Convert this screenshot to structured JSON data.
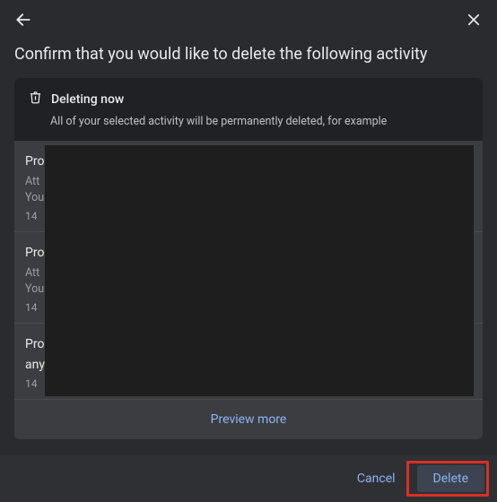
{
  "header": {
    "title": "Confirm that you would like to delete the following activity"
  },
  "banner": {
    "title": "Deleting now",
    "subtitle": "All of your selected activity will be permanently deleted, for example"
  },
  "items": [
    {
      "title": "Pro",
      "line1": "Att",
      "line2": "You",
      "time": "14"
    },
    {
      "title": "Pro",
      "line1": "Att",
      "line2": "You",
      "time": "14"
    },
    {
      "title": "Pro",
      "title2": "any",
      "line1": "",
      "line2": "",
      "time": "14"
    }
  ],
  "preview_more": "Preview more",
  "footer": {
    "cancel": "Cancel",
    "delete": "Delete"
  }
}
